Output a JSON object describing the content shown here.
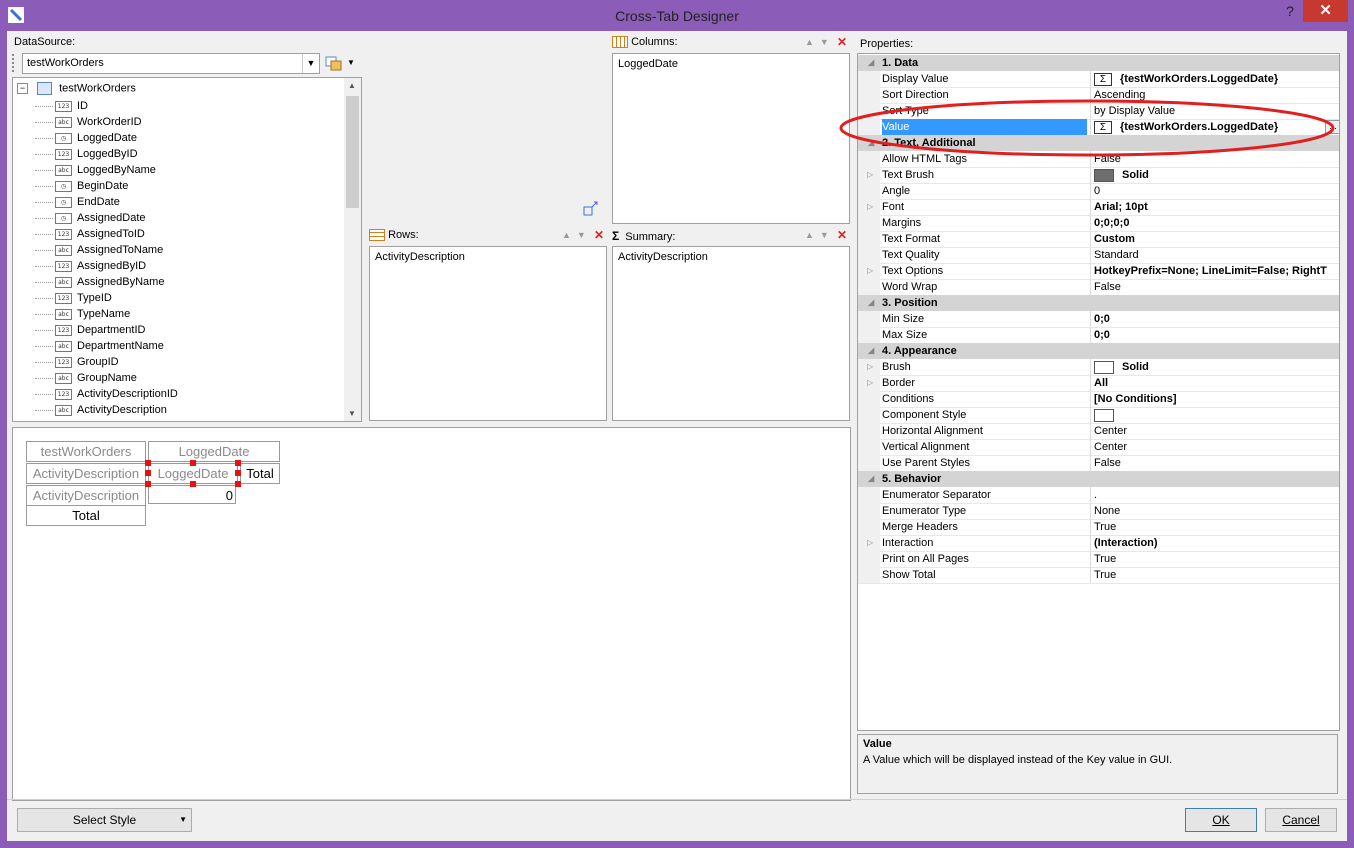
{
  "window": {
    "title": "Cross-Tab Designer",
    "help": "?",
    "close": "✕"
  },
  "datasource": {
    "label": "DataSource:",
    "selected": "testWorkOrders",
    "tree_root": "testWorkOrders",
    "fields": [
      {
        "name": "ID",
        "type": "123"
      },
      {
        "name": "WorkOrderID",
        "type": "abc"
      },
      {
        "name": "LoggedDate",
        "type": "clock"
      },
      {
        "name": "LoggedByID",
        "type": "123"
      },
      {
        "name": "LoggedByName",
        "type": "abc"
      },
      {
        "name": "BeginDate",
        "type": "clock"
      },
      {
        "name": "EndDate",
        "type": "clock"
      },
      {
        "name": "AssignedDate",
        "type": "clock"
      },
      {
        "name": "AssignedToID",
        "type": "123"
      },
      {
        "name": "AssignedToName",
        "type": "abc"
      },
      {
        "name": "AssignedByID",
        "type": "123"
      },
      {
        "name": "AssignedByName",
        "type": "abc"
      },
      {
        "name": "TypeID",
        "type": "123"
      },
      {
        "name": "TypeName",
        "type": "abc"
      },
      {
        "name": "DepartmentID",
        "type": "123"
      },
      {
        "name": "DepartmentName",
        "type": "abc"
      },
      {
        "name": "GroupID",
        "type": "123"
      },
      {
        "name": "GroupName",
        "type": "abc"
      },
      {
        "name": "ActivityDescriptionID",
        "type": "123"
      },
      {
        "name": "ActivityDescription",
        "type": "abc"
      }
    ]
  },
  "columns": {
    "label": "Columns:",
    "items": [
      "LoggedDate"
    ]
  },
  "rows": {
    "label": "Rows:",
    "items": [
      "ActivityDescription"
    ]
  },
  "summary": {
    "label": "Summary:",
    "items": [
      "ActivityDescription"
    ]
  },
  "preview": {
    "corner": "testWorkOrders",
    "col_header": "LoggedDate",
    "row_header": "ActivityDescription",
    "col_field": "LoggedDate",
    "col_total": "Total",
    "row_field": "ActivityDescription",
    "value": "0",
    "row_total": "Total"
  },
  "properties": {
    "label": "Properties:",
    "categories": [
      {
        "title": "1. Data",
        "rows": [
          {
            "name": "Display Value",
            "value": "{testWorkOrders.LoggedDate}",
            "bold": true,
            "icon": "sigma"
          },
          {
            "name": "Sort Direction",
            "value": "Ascending"
          },
          {
            "name": "Sort Type",
            "value": "by Display Value"
          },
          {
            "name": "Value",
            "value": "{testWorkOrders.LoggedDate}",
            "bold": true,
            "icon": "sigma",
            "selected": true,
            "ellipsis": "..."
          }
        ]
      },
      {
        "title": "2. Text, Additional",
        "rows": [
          {
            "name": "Allow HTML Tags",
            "value": "False"
          },
          {
            "name": "Text Brush",
            "value": "Solid",
            "bold": true,
            "icon": "swatch-gray",
            "expand": true
          },
          {
            "name": "Angle",
            "value": "0"
          },
          {
            "name": "Font",
            "value": "Arial; 10pt",
            "bold": true,
            "expand": true
          },
          {
            "name": "Margins",
            "value": "0;0;0;0",
            "bold": true
          },
          {
            "name": "Text Format",
            "value": "Custom",
            "bold": true
          },
          {
            "name": "Text Quality",
            "value": "Standard"
          },
          {
            "name": "Text Options",
            "value": "HotkeyPrefix=None; LineLimit=False; RightT",
            "bold": true,
            "expand": true
          },
          {
            "name": "Word Wrap",
            "value": "False"
          }
        ]
      },
      {
        "title": "3. Position",
        "rows": [
          {
            "name": "Min Size",
            "value": "0;0",
            "bold": true
          },
          {
            "name": "Max Size",
            "value": "0;0",
            "bold": true
          }
        ]
      },
      {
        "title": "4. Appearance",
        "rows": [
          {
            "name": "Brush",
            "value": "Solid",
            "bold": true,
            "icon": "swatch-white",
            "expand": true
          },
          {
            "name": "Border",
            "value": "All",
            "bold": true,
            "expand": true
          },
          {
            "name": "Conditions",
            "value": "[No Conditions]",
            "bold": true
          },
          {
            "name": "Component Style",
            "value": "",
            "icon": "swatch-white"
          },
          {
            "name": "Horizontal Alignment",
            "value": "Center"
          },
          {
            "name": "Vertical Alignment",
            "value": "Center"
          },
          {
            "name": "Use Parent Styles",
            "value": "False"
          }
        ]
      },
      {
        "title": "5. Behavior",
        "rows": [
          {
            "name": "Enumerator Separator",
            "value": "."
          },
          {
            "name": "Enumerator Type",
            "value": "None"
          },
          {
            "name": "Merge Headers",
            "value": "True"
          },
          {
            "name": "Interaction",
            "value": "(Interaction)",
            "bold": true,
            "expand": true
          },
          {
            "name": "Print on All Pages",
            "value": "True"
          },
          {
            "name": "Show Total",
            "value": "True"
          }
        ]
      }
    ],
    "description_title": "Value",
    "description_text": "A Value which will be displayed instead of the Key value in GUI."
  },
  "footer": {
    "select_style": "Select Style",
    "ok": "OK",
    "cancel": "Cancel"
  },
  "colors": {
    "chrome": "#8b5cb8",
    "selection": "#3399ff",
    "annotation": "#e02020"
  }
}
